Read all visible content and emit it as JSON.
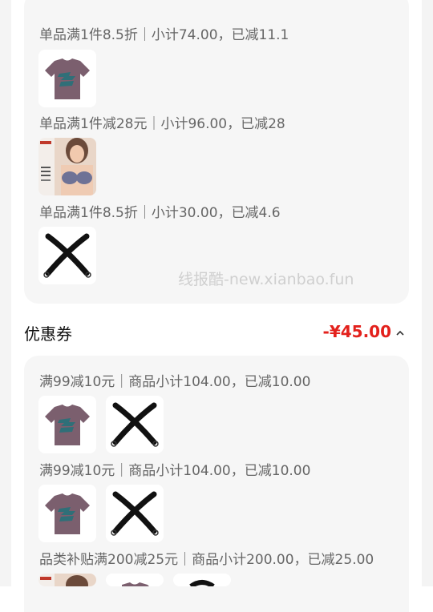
{
  "top_card": {
    "lines": [
      "单品满1件8.5折｜小计74.00，已减11.1",
      "单品满1件减28元｜小计96.00，已减28",
      "单品满1件8.5折｜小计30.00，已减4.6"
    ],
    "watermark": "线报酷-new.xianbao.fun"
  },
  "coupon": {
    "title": "优惠券",
    "amount": "-¥45.00",
    "lines": [
      "满99减10元｜商品小计104.00，已减10.00",
      "满99减10元｜商品小计104.00，已减10.00",
      "品类补贴满200减25元｜商品小计200.00，已减25.00"
    ]
  },
  "product_images": {
    "tshirt": "purple t-shirt with teal print",
    "bra": "lingerie product photo",
    "strap": "black adjustable strap with hooks"
  },
  "colors": {
    "accent": "#e3211c",
    "card_bg": "#f6f6f6",
    "tshirt": "#7b5f6e",
    "print": "#2f6f78"
  },
  "icons": {
    "collapse": "chevron-up-icon"
  }
}
